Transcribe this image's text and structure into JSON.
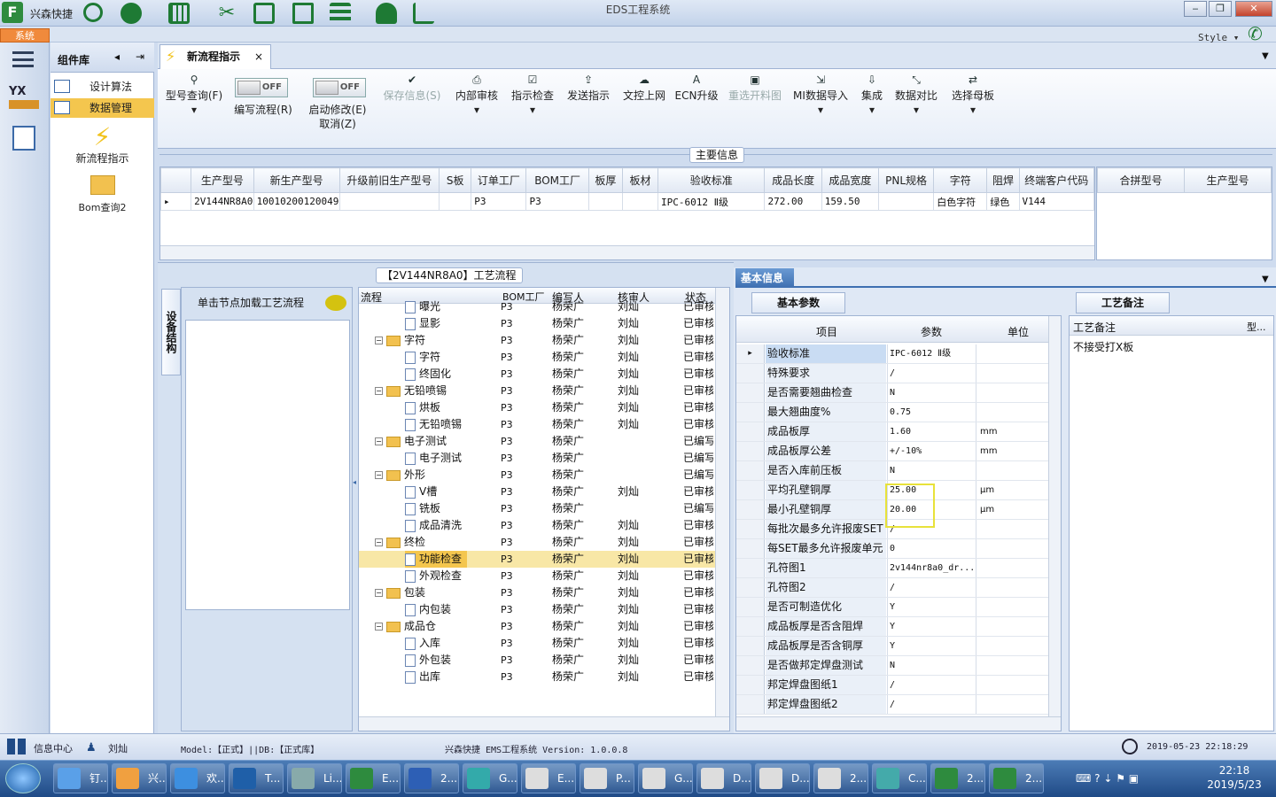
{
  "window": {
    "title": "EDS工程系统",
    "app_name": "兴森快捷",
    "menu_tab": "系统",
    "style_label": "Style"
  },
  "component_lib": {
    "title": "组件库",
    "items": [
      {
        "label": "设计算法"
      },
      {
        "label": "数据管理"
      }
    ],
    "big_items": [
      {
        "label": "新流程指示"
      },
      {
        "label": "Bom查询2"
      }
    ]
  },
  "doc_tab": {
    "label": "新流程指示"
  },
  "ribbon": {
    "buttons": [
      {
        "label": "型号查询(F)"
      },
      {
        "label": "保存信息(S)"
      },
      {
        "label": "内部审核"
      },
      {
        "label": "指示检查"
      },
      {
        "label": "发送指示"
      },
      {
        "label": "文控上网"
      },
      {
        "label": "ECN升级"
      },
      {
        "label": "重选开料图"
      },
      {
        "label": "MI数据导入"
      },
      {
        "label": "集成"
      },
      {
        "label": "数据对比"
      },
      {
        "label": "选择母板"
      }
    ],
    "toggles": [
      {
        "label": "编写流程(R)",
        "state": "OFF"
      },
      {
        "label": "启动修改(E)",
        "label2": "取消(Z)",
        "state": "OFF"
      }
    ]
  },
  "main_info": {
    "title": "主要信息",
    "columns": [
      "生产型号",
      "新生产型号",
      "升级前旧生产型号",
      "S板",
      "订单工厂",
      "BOM工厂",
      "板厚",
      "板材",
      "验收标准",
      "成品长度",
      "成品宽度",
      "PNL规格",
      "字符",
      "阻焊",
      "终端客户代码"
    ],
    "row": [
      "2V144NR8A0",
      "10010200120049",
      "",
      "",
      "P3",
      "P3",
      "",
      "",
      "IPC-6012 Ⅱ级",
      "272.00",
      "159.50",
      "",
      "白色字符",
      "绿色",
      "V144"
    ],
    "side_columns": [
      "合拼型号",
      "生产型号"
    ]
  },
  "process": {
    "title": "【2V144NR8A0】工艺流程",
    "side_tab": "设备结构",
    "hint": "单击节点加载工艺流程",
    "columns": [
      "流程",
      "BOM工厂",
      "编写人",
      "核审人",
      "状态"
    ],
    "rows": [
      {
        "name": "曝光",
        "level": 2,
        "factory": "P3",
        "writer": "杨荣广",
        "checker": "刘灿",
        "status": "已审核"
      },
      {
        "name": "显影",
        "level": 2,
        "factory": "P3",
        "writer": "杨荣广",
        "checker": "刘灿",
        "status": "已审核"
      },
      {
        "name": "字符",
        "level": 1,
        "factory": "P3",
        "writer": "杨荣广",
        "checker": "刘灿",
        "status": "已审核"
      },
      {
        "name": "字符",
        "level": 2,
        "factory": "P3",
        "writer": "杨荣广",
        "checker": "刘灿",
        "status": "已审核"
      },
      {
        "name": "终固化",
        "level": 2,
        "factory": "P3",
        "writer": "杨荣广",
        "checker": "刘灿",
        "status": "已审核"
      },
      {
        "name": "无铅喷锡",
        "level": 1,
        "factory": "P3",
        "writer": "杨荣广",
        "checker": "刘灿",
        "status": "已审核"
      },
      {
        "name": "烘板",
        "level": 2,
        "factory": "P3",
        "writer": "杨荣广",
        "checker": "刘灿",
        "status": "已审核"
      },
      {
        "name": "无铅喷锡",
        "level": 2,
        "factory": "P3",
        "writer": "杨荣广",
        "checker": "刘灿",
        "status": "已审核"
      },
      {
        "name": "电子测试",
        "level": 1,
        "factory": "P3",
        "writer": "杨荣广",
        "checker": "",
        "status": "已编写"
      },
      {
        "name": "电子测试",
        "level": 2,
        "factory": "P3",
        "writer": "杨荣广",
        "checker": "",
        "status": "已编写"
      },
      {
        "name": "外形",
        "level": 1,
        "factory": "P3",
        "writer": "杨荣广",
        "checker": "",
        "status": "已编写"
      },
      {
        "name": "V槽",
        "level": 2,
        "factory": "P3",
        "writer": "杨荣广",
        "checker": "刘灿",
        "status": "已审核"
      },
      {
        "name": "铣板",
        "level": 2,
        "factory": "P3",
        "writer": "杨荣广",
        "checker": "",
        "status": "已编写"
      },
      {
        "name": "成品清洗",
        "level": 2,
        "factory": "P3",
        "writer": "杨荣广",
        "checker": "刘灿",
        "status": "已审核"
      },
      {
        "name": "终检",
        "level": 1,
        "factory": "P3",
        "writer": "杨荣广",
        "checker": "刘灿",
        "status": "已审核"
      },
      {
        "name": "功能检查",
        "level": 2,
        "factory": "P3",
        "writer": "杨荣广",
        "checker": "刘灿",
        "status": "已审核",
        "selected": true
      },
      {
        "name": "外观检查",
        "level": 2,
        "factory": "P3",
        "writer": "杨荣广",
        "checker": "刘灿",
        "status": "已审核"
      },
      {
        "name": "包装",
        "level": 1,
        "factory": "P3",
        "writer": "杨荣广",
        "checker": "刘灿",
        "status": "已审核"
      },
      {
        "name": "内包装",
        "level": 2,
        "factory": "P3",
        "writer": "杨荣广",
        "checker": "刘灿",
        "status": "已审核"
      },
      {
        "name": "成品仓",
        "level": 1,
        "factory": "P3",
        "writer": "杨荣广",
        "checker": "刘灿",
        "status": "已审核"
      },
      {
        "name": "入库",
        "level": 2,
        "factory": "P3",
        "writer": "杨荣广",
        "checker": "刘灿",
        "status": "已审核"
      },
      {
        "name": "外包装",
        "level": 2,
        "factory": "P3",
        "writer": "杨荣广",
        "checker": "刘灿",
        "status": "已审核"
      },
      {
        "name": "出库",
        "level": 2,
        "factory": "P3",
        "writer": "杨荣广",
        "checker": "刘灿",
        "status": "已审核"
      }
    ]
  },
  "basic_info": {
    "title": "基本信息",
    "tab": "基本参数",
    "columns": [
      "项目",
      "参数",
      "单位"
    ],
    "rows": [
      [
        "验收标准",
        "IPC-6012 Ⅱ级",
        ""
      ],
      [
        "特殊要求",
        "/",
        ""
      ],
      [
        "是否需要翘曲检查",
        "N",
        ""
      ],
      [
        "最大翘曲度%",
        "0.75",
        ""
      ],
      [
        "成品板厚",
        "1.60",
        "mm"
      ],
      [
        "成品板厚公差",
        "+/-10%",
        "mm"
      ],
      [
        "是否入库前压板",
        "N",
        ""
      ],
      [
        "平均孔壁铜厚",
        "25.00",
        "μm"
      ],
      [
        "最小孔壁铜厚",
        "20.00",
        "μm"
      ],
      [
        "每批次最多允许报废SET",
        "/",
        ""
      ],
      [
        "每SET最多允许报废单元",
        "0",
        ""
      ],
      [
        "孔符图1",
        "2v144nr8a0_dr...",
        ""
      ],
      [
        "孔符图2",
        "/",
        ""
      ],
      [
        "是否可制造优化",
        "Y",
        ""
      ],
      [
        "成品板厚是否含阻焊",
        "Y",
        ""
      ],
      [
        "成品板厚是否含铜厚",
        "Y",
        ""
      ],
      [
        "是否做邦定焊盘测试",
        "N",
        ""
      ],
      [
        "邦定焊盘图纸1",
        "/",
        ""
      ],
      [
        "邦定焊盘图纸2",
        "/",
        ""
      ]
    ]
  },
  "craft_note": {
    "tab": "工艺备注",
    "col1": "工艺备注",
    "col2": "型...",
    "value": "不接受打X板"
  },
  "status": {
    "center": "信息中心",
    "user": "刘灿",
    "model": "Model:【正式】||DB:【正式库】",
    "version": "兴森快捷 EMS工程系统 Version: 1.0.0.8",
    "datetime": "2019-05-23 22:18:29"
  },
  "taskbar": {
    "items": [
      "钉...",
      "兴...",
      "欢...",
      "T...",
      "Li...",
      "E...",
      "2...",
      "G...",
      "E...",
      "P...",
      "G...",
      "D...",
      "D...",
      "2...",
      "C...",
      "2...",
      "2..."
    ],
    "time": "22:18",
    "date": "2019/5/23"
  },
  "colors": {
    "accent": "#3e6fb1",
    "selection": "#f4c64e",
    "highlight_box": "#e8e23a"
  }
}
